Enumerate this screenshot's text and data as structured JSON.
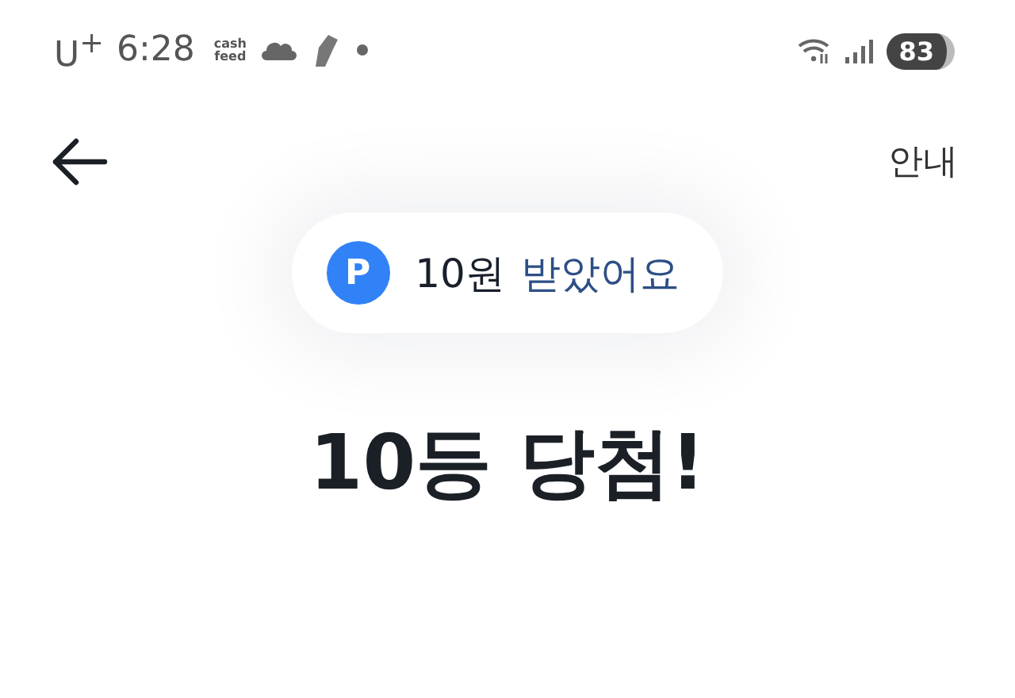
{
  "status_bar": {
    "carrier": "U$^{+}$",
    "time": "6:28",
    "app_logo_lines": [
      "cash",
      "feed"
    ],
    "battery": "83"
  },
  "header": {
    "info_link": "안내"
  },
  "reward_pill": {
    "icon_letter": "P",
    "amount": "10원",
    "message": "받았어요"
  },
  "headline": "10등 당첨!"
}
